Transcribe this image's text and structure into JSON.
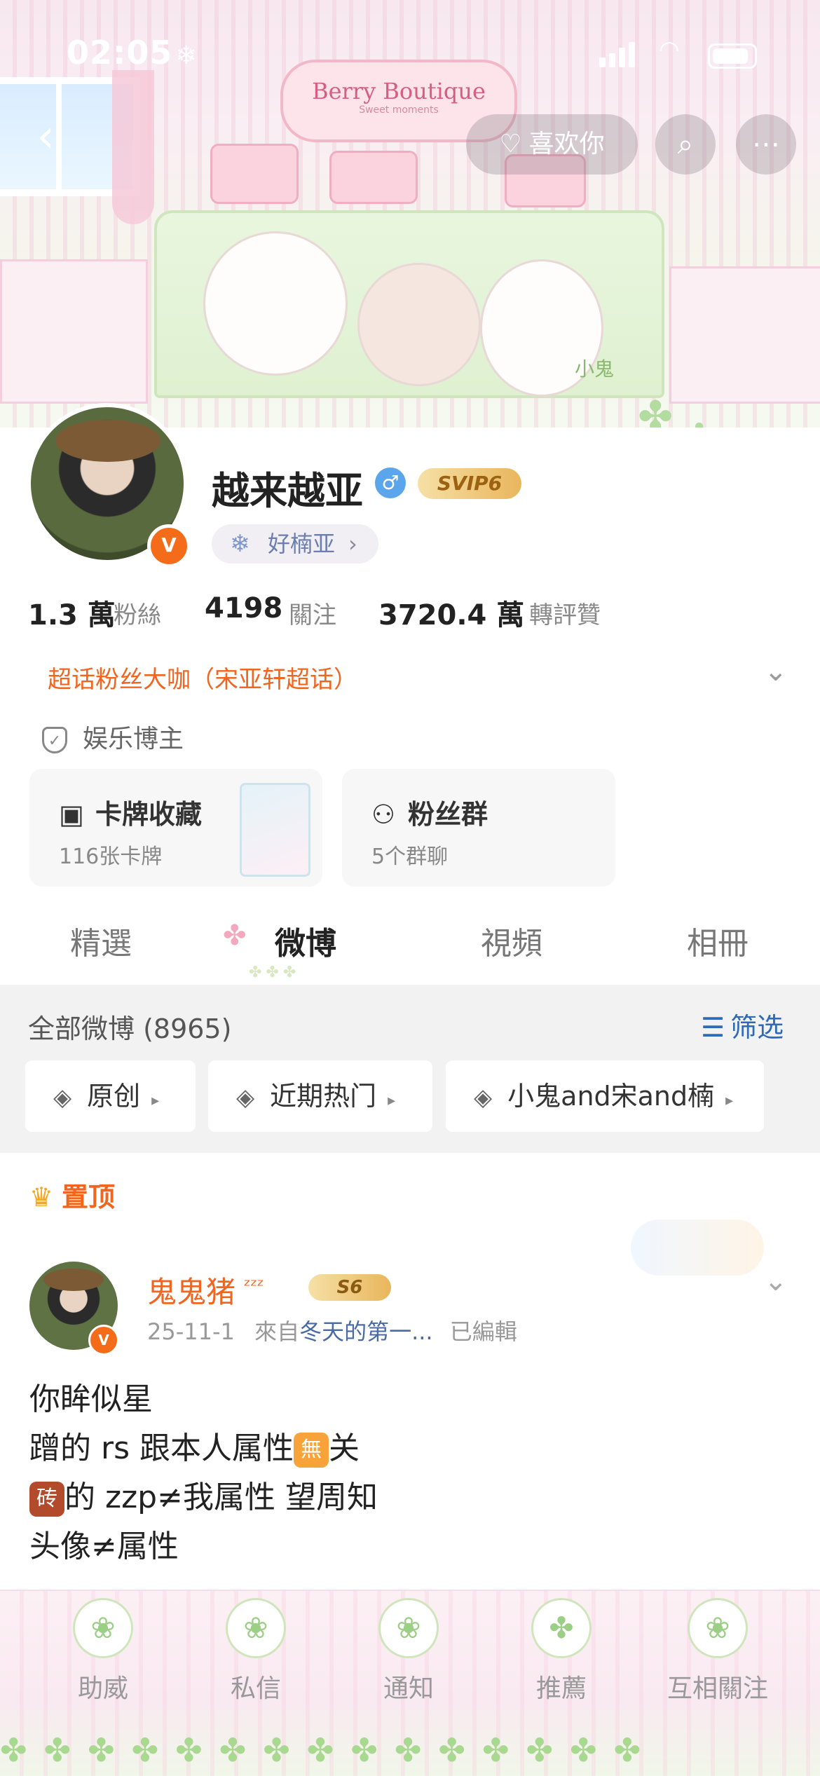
{
  "status_bar": {
    "time": "02:05",
    "time_icon": "snowflake-icon"
  },
  "header": {
    "banner_sign_title": "Berry Boutique",
    "banner_sign_sub": "Sweet moments",
    "banner_art_label": "小鬼",
    "like_button_label": "喜欢你",
    "icons": {
      "back": "chevron-left-icon",
      "like": "peach-icon",
      "search": "search-icon",
      "more": "more-icon"
    }
  },
  "profile": {
    "username": "越来越亚",
    "gender_symbol": "♂",
    "vip_badge": "SVIP6",
    "verified_letter": "V",
    "fan_chip": {
      "icon": "snowflake-icon",
      "label": "好楠亚",
      "chevron": "›"
    },
    "stats": [
      {
        "value": "1.3 萬",
        "label": "粉絲"
      },
      {
        "value": "4198",
        "label": "關注"
      },
      {
        "value": "3720.4 萬",
        "label": "轉評贊"
      }
    ],
    "supertopic": "超话粉丝大咖（宋亚轩超话）",
    "certification": "娱乐博主",
    "cards": [
      {
        "icon": "card-icon",
        "title": "卡牌收藏",
        "sub": "116张卡牌"
      },
      {
        "icon": "people-icon",
        "title": "粉丝群",
        "sub": "5个群聊"
      }
    ]
  },
  "tabs": [
    {
      "label": "精選",
      "active": false
    },
    {
      "label": "微博",
      "active": true
    },
    {
      "label": "視頻",
      "active": false
    },
    {
      "label": "相冊",
      "active": false
    }
  ],
  "filter": {
    "all_label": "全部微博 (8965)",
    "screen_label": "筛选",
    "chips": [
      "原创",
      "近期热门",
      "小鬼and宋and楠"
    ]
  },
  "post": {
    "pinned_label": "置顶",
    "author": "鬼鬼猪",
    "author_suffix": "ᶻᶻᶻ",
    "author_badge": "S6",
    "date": "25-11-1",
    "source_prefix": "來自",
    "source": "冬天的第一...",
    "edited": "已編輯",
    "lines": [
      {
        "pre": "你眸似星",
        "emoji": "",
        "post": ""
      },
      {
        "pre": "蹭的 rs 跟本人属性",
        "emoji": "無",
        "post": "关"
      },
      {
        "pre": "",
        "emoji": "砖",
        "post": "的 zzp≠我属性 望周知"
      },
      {
        "pre": "头像≠属性",
        "emoji": "",
        "post": ""
      }
    ]
  },
  "tabbar": [
    {
      "label": "助威",
      "icon": "strawberry-icon"
    },
    {
      "label": "私信",
      "icon": "bunny-icon"
    },
    {
      "label": "通知",
      "icon": "bear-icon"
    },
    {
      "label": "推薦",
      "icon": "clover-icon"
    },
    {
      "label": "互相關注",
      "icon": "bunny-icon"
    }
  ]
}
